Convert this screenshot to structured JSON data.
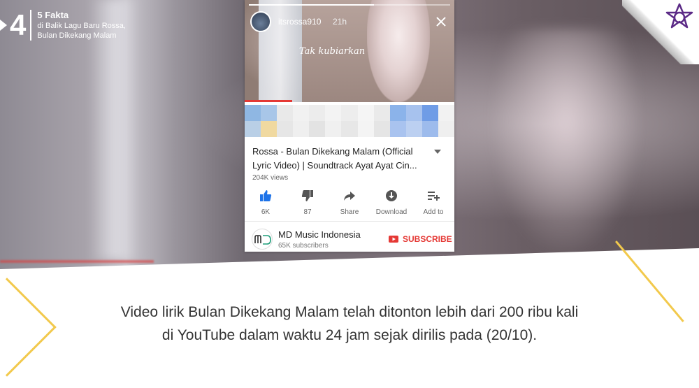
{
  "badge": {
    "number": "4",
    "title": "5 Fakta",
    "line1": "di Balik Lagu Baru Rossa,",
    "line2": "Bulan Dikekang Malam"
  },
  "story": {
    "username": "itsrossa910",
    "time": "21h",
    "overlay_text": "Tak kubiarkan",
    "progress_fraction": 0.62
  },
  "video": {
    "title": "Rossa - Bulan Dikekang Malam (Official Lyric Video) | Soundtrack Ayat Ayat Cin...",
    "views": "204K views",
    "actions": [
      {
        "label": "6K",
        "icon": "thumbs-up-icon"
      },
      {
        "label": "87",
        "icon": "thumbs-down-icon"
      },
      {
        "label": "Share",
        "icon": "share-icon"
      },
      {
        "label": "Download",
        "icon": "download-icon"
      },
      {
        "label": "Add to",
        "icon": "playlist-add-icon"
      }
    ]
  },
  "channel": {
    "name": "MD Music Indonesia",
    "subscribers": "65K subscribers",
    "subscribe_label": "SUBSCRIBE"
  },
  "caption": {
    "line1": "Video lirik Bulan Dikekang Malam telah ditonton lebih dari 200 ribu kali",
    "line2": "di YouTube dalam waktu 24 jam sejak dirilis pada (20/10)."
  },
  "colors": {
    "accent_red": "#e53935",
    "like_blue": "#1e73e8",
    "gold": "#f2c94c",
    "logo_purple": "#5b2a86"
  }
}
